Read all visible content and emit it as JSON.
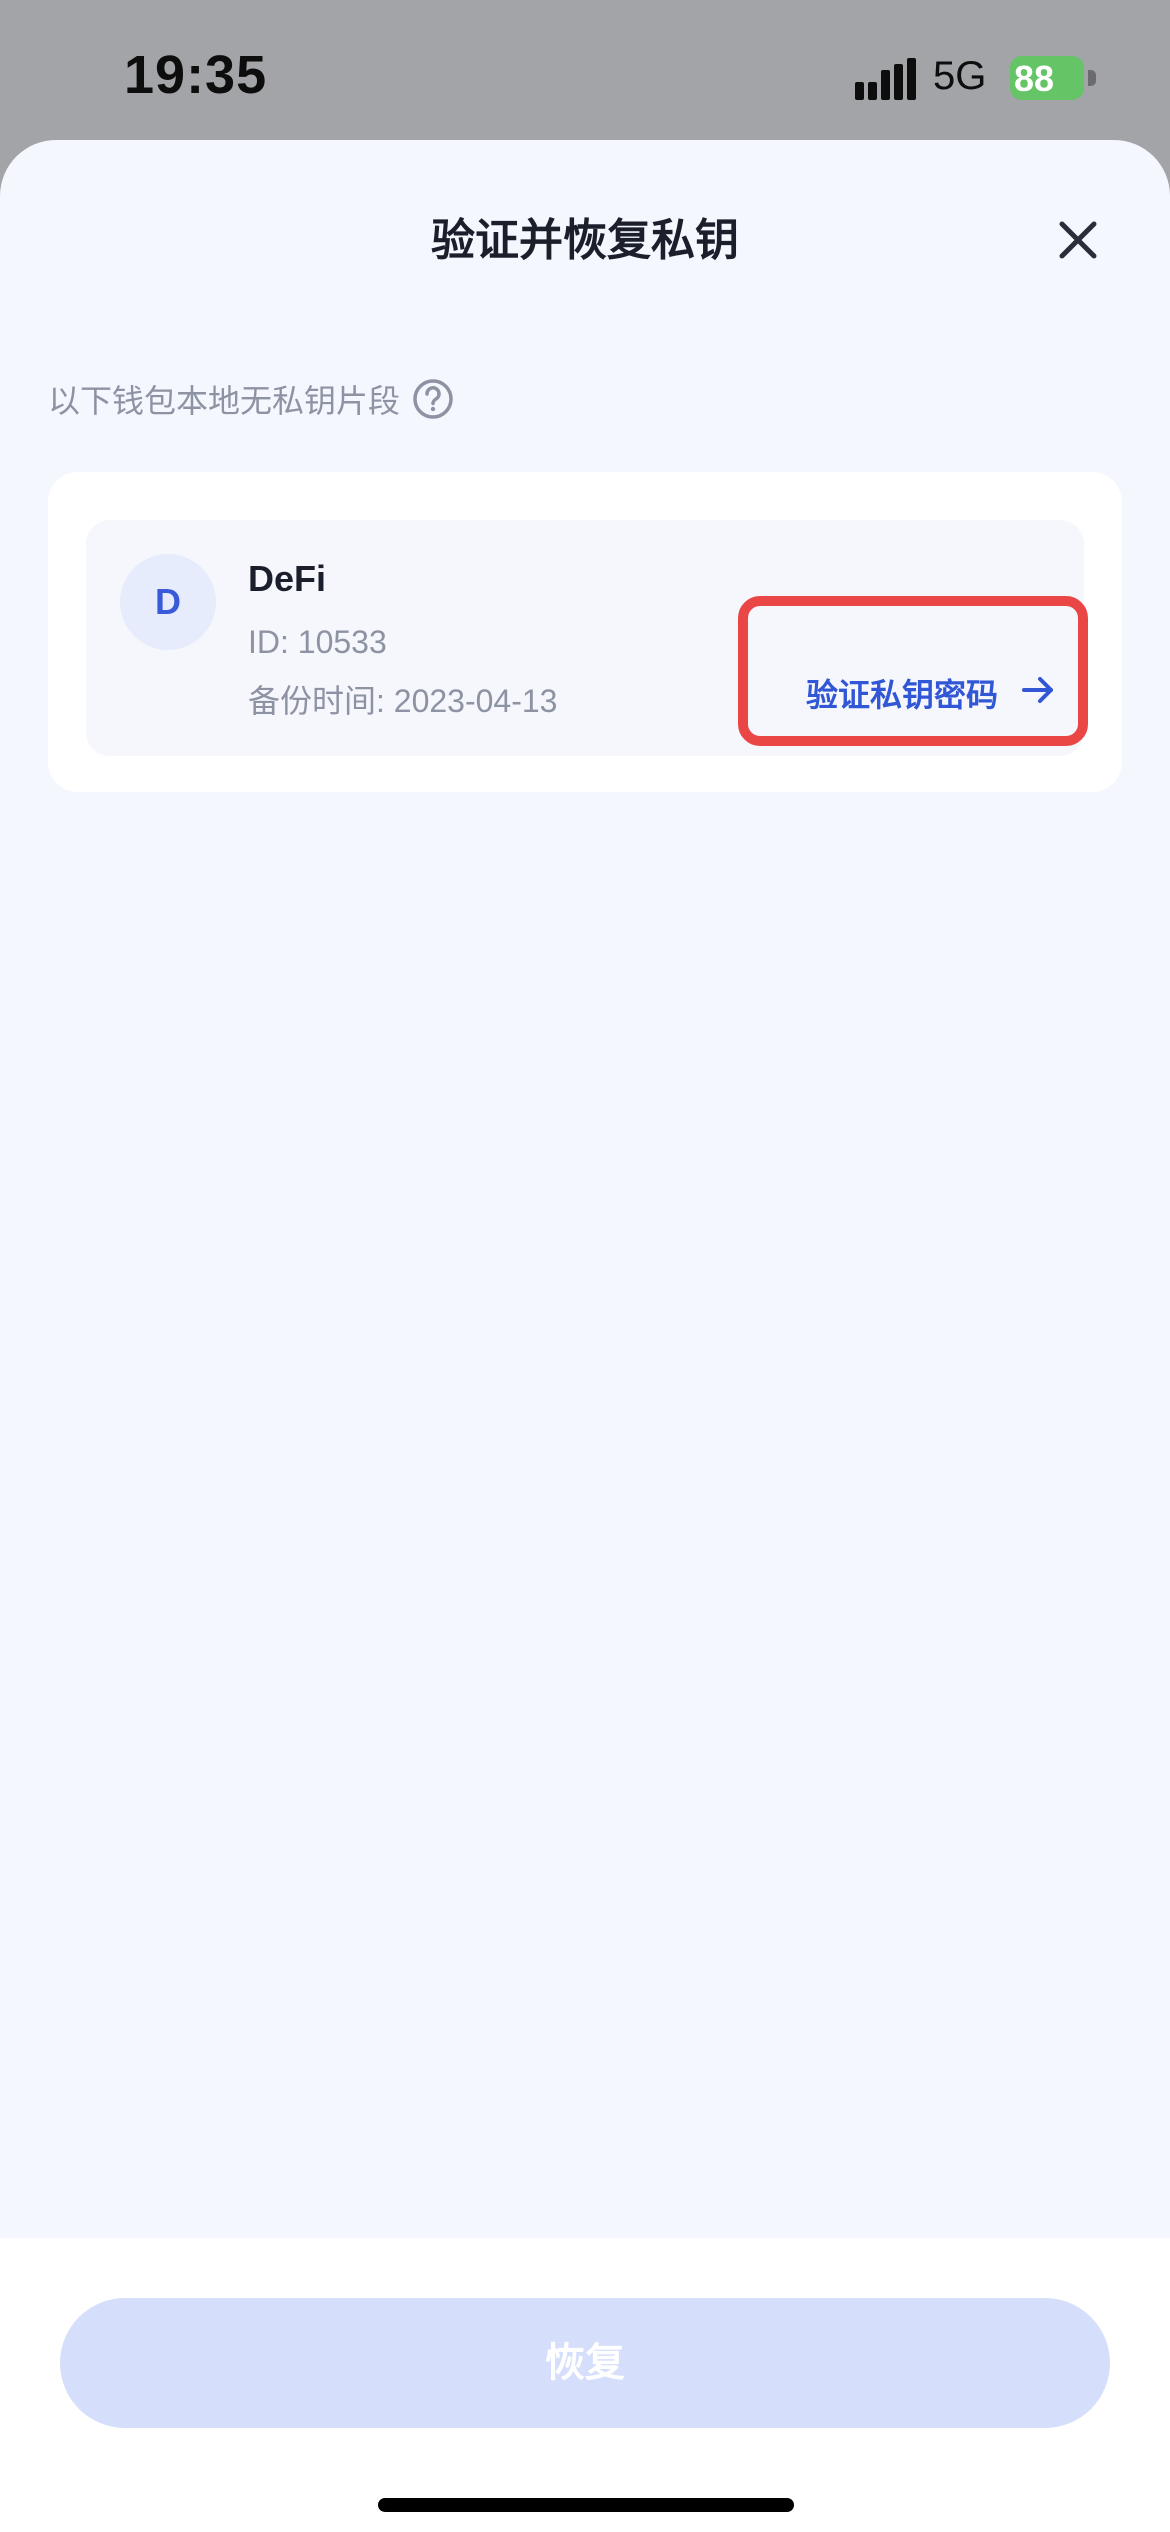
{
  "status_bar": {
    "time": "19:35",
    "network": "5G",
    "battery": "88"
  },
  "sheet": {
    "title": "验证并恢复私钥",
    "section_label": "以下钱包本地无私钥片段"
  },
  "wallet": {
    "avatar_letter": "D",
    "name": "DeFi",
    "id_text": "ID: 10533",
    "backup_text": "备份时间: 2023-04-13",
    "verify_label": "验证私钥密码"
  },
  "footer": {
    "restore_label": "恢复"
  },
  "colors": {
    "accent": "#3257d6",
    "highlight_border": "#ea4646",
    "battery_green": "#64c466",
    "disabled_button": "#d5defb"
  }
}
